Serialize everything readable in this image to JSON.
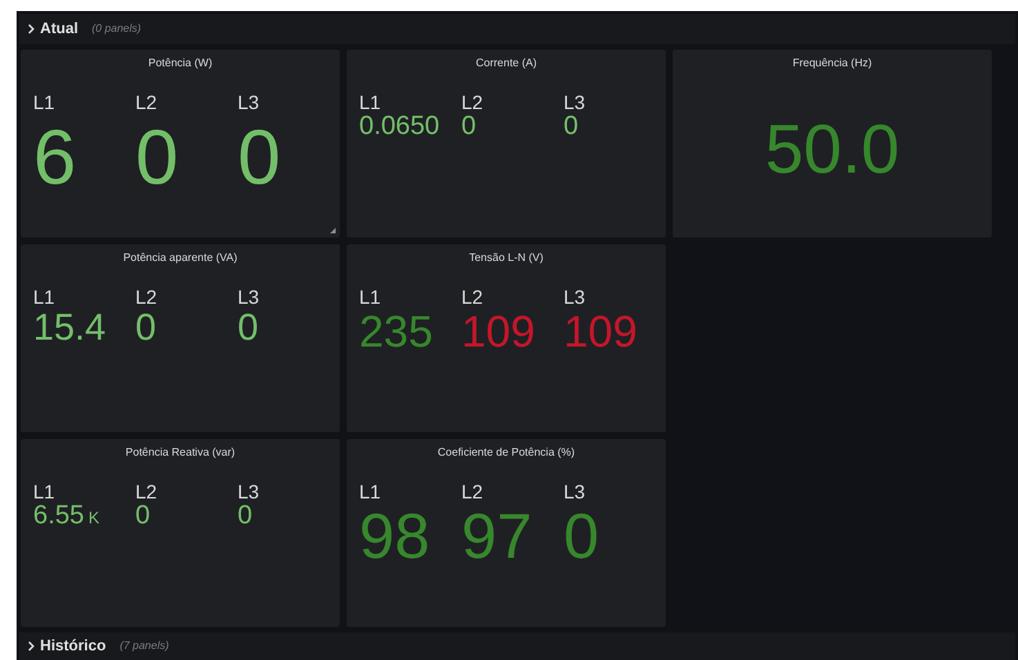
{
  "rows_top": {
    "title": "Atual",
    "count": "(0 panels)"
  },
  "panels": [
    {
      "title": "Potência (W)",
      "stats": [
        {
          "label": "L1",
          "value": "6",
          "color": "#73bf69"
        },
        {
          "label": "L2",
          "value": "0",
          "color": "#73bf69"
        },
        {
          "label": "L3",
          "value": "0",
          "color": "#73bf69"
        }
      ]
    },
    {
      "title": "Corrente (A)",
      "stats": [
        {
          "label": "L1",
          "value": "0.0650",
          "color": "#73bf69"
        },
        {
          "label": "L2",
          "value": "0",
          "color": "#73bf69"
        },
        {
          "label": "L3",
          "value": "0",
          "color": "#73bf69"
        }
      ]
    },
    {
      "title": "Frequência (Hz)",
      "stats": [
        {
          "value": "50.0",
          "color": "#37872d"
        }
      ]
    },
    {
      "title": "Potência aparente (VA)",
      "stats": [
        {
          "label": "L1",
          "value": "15.4",
          "color": "#73bf69"
        },
        {
          "label": "L2",
          "value": "0",
          "color": "#73bf69"
        },
        {
          "label": "L3",
          "value": "0",
          "color": "#73bf69"
        }
      ]
    },
    {
      "title": "Tensão L-N (V)",
      "stats": [
        {
          "label": "L1",
          "value": "235",
          "color": "#37872d"
        },
        {
          "label": "L2",
          "value": "109",
          "color": "#c4162a"
        },
        {
          "label": "L3",
          "value": "109",
          "color": "#c4162a"
        }
      ]
    },
    {
      "title": "Potência Reativa (var)",
      "stats": [
        {
          "label": "L1",
          "value": "6.55",
          "unit": "K",
          "color": "#73bf69"
        },
        {
          "label": "L2",
          "value": "0",
          "color": "#73bf69"
        },
        {
          "label": "L3",
          "value": "0",
          "color": "#73bf69"
        }
      ]
    },
    {
      "title": "Coeficiente de Potência (%)",
      "stats": [
        {
          "label": "L1",
          "value": "98",
          "color": "#37872d"
        },
        {
          "label": "L2",
          "value": "97",
          "color": "#37872d"
        },
        {
          "label": "L3",
          "value": "0",
          "color": "#37872d"
        }
      ]
    }
  ],
  "rows_bottom": {
    "title": "Histórico",
    "count": "(7 panels)"
  }
}
